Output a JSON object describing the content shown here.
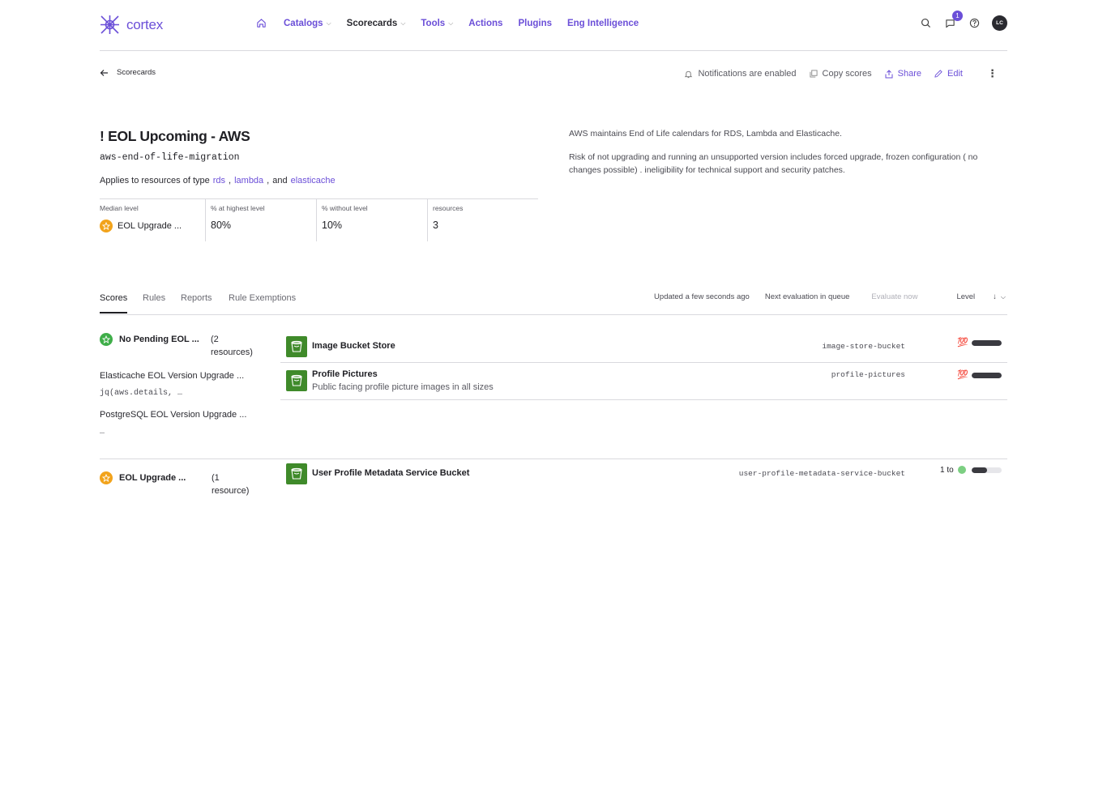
{
  "app": {
    "logo_text": "cortex",
    "brand_color": "#6b4fd8"
  },
  "nav": {
    "items": [
      {
        "label": "Catalogs",
        "has_menu": true
      },
      {
        "label": "Scorecards",
        "has_menu": true
      },
      {
        "label": "Tools",
        "has_menu": true
      },
      {
        "label": "Actions",
        "has_menu": false
      },
      {
        "label": "Plugins",
        "has_menu": false
      },
      {
        "label": "Eng Intelligence",
        "has_menu": false
      }
    ],
    "notification_count": "1",
    "avatar_initials": "LC"
  },
  "subheader": {
    "back_label": "Scorecards",
    "notifications": "Notifications are enabled",
    "copy_scores": "Copy scores",
    "share": "Share",
    "edit": "Edit"
  },
  "scorecard": {
    "title": "! EOL Upcoming - AWS",
    "tag": "aws-end-of-life-migration",
    "applies_prefix": "Applies to resources of type",
    "types": [
      "rds",
      "lambda",
      "elasticache"
    ],
    "applies_and": "and",
    "description": [
      "AWS maintains End of Life calendars for RDS, Lambda and Elasticache.",
      "Risk of not upgrading and running an unsupported version includes forced upgrade, frozen configuration ( no changes possible) . ineligibility for technical support and security patches."
    ],
    "stats": {
      "median_label": "Median level",
      "median_value": "EOL Upgrade ...",
      "highest_label": "% at highest level",
      "highest_value": "80%",
      "without_label": "% without level",
      "without_value": "10%",
      "resources_label": "resources",
      "resources_value": "3"
    }
  },
  "tabs": {
    "items": [
      "Scores",
      "Rules",
      "Reports",
      "Rule Exemptions"
    ],
    "active": "Scores",
    "updated": "Updated a few seconds ago",
    "next_eval": "Next evaluation in queue",
    "evaluate": "Evaluate now",
    "sort": "Level"
  },
  "groups": [
    {
      "level": "No Pending EOL ...",
      "level_color": "#3fae49",
      "count_line1": "(2",
      "count_line2": "resources)",
      "rules": [
        {
          "name": "Elasticache EOL Version Upgrade ...",
          "code": "jq(aws.details, …"
        },
        {
          "name": "PostgreSQL EOL Version Upgrade ...",
          "code": "…"
        }
      ],
      "entities": [
        {
          "name": "Image Bucket Store",
          "description": "",
          "tag": "image-store-bucket",
          "score_emoji": "💯",
          "progress": 1.0
        },
        {
          "name": "Profile Pictures",
          "description": "Public facing profile picture images in all sizes",
          "tag": "profile-pictures",
          "score_emoji": "💯",
          "progress": 1.0
        }
      ]
    },
    {
      "level": "EOL Upgrade ...",
      "level_color": "#f2a31b",
      "count_line1": "(1",
      "count_line2": "resource)",
      "entities": [
        {
          "name": "User Profile Metadata Service Bucket",
          "tag": "user-profile-metadata-service-bucket",
          "score_text": "1 to",
          "progress": 0.5
        }
      ]
    }
  ]
}
